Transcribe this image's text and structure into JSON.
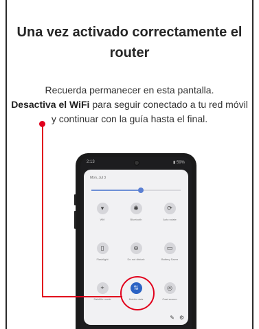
{
  "header": {
    "title": "Una vez activado correctamente el router"
  },
  "description": {
    "line1": "Recuerda permanecer en esta pantalla.",
    "bold": "Desactiva el WiFi",
    "rest": " para seguir conectado a tu red móvil y continuar con la guía hasta el final."
  },
  "phone": {
    "status": {
      "time": "2:13",
      "battery": "▮ 59%"
    },
    "panel": {
      "date": "Mon, Jul 3",
      "brightness_level": 0.55,
      "tiles": [
        {
          "label": "Wifi",
          "icon": "wifi-icon",
          "glyph": "▾"
        },
        {
          "label": "Bluetooth",
          "icon": "bluetooth-icon",
          "glyph": "✱"
        },
        {
          "label": "Auto rotate",
          "icon": "auto-rotate-icon",
          "glyph": "⟳"
        },
        {
          "label": "Flashlight",
          "icon": "flashlight-icon",
          "glyph": "▯"
        },
        {
          "label": "Do not disturb",
          "icon": "do-not-disturb-icon",
          "glyph": "⊖"
        },
        {
          "label": "Battery Saver",
          "icon": "battery-saver-icon",
          "glyph": "▭"
        },
        {
          "label": "Satellite mode",
          "icon": "add-icon",
          "glyph": "+"
        },
        {
          "label": "Mobile data",
          "icon": "mobile-data-icon",
          "glyph": "⇅",
          "active": true
        },
        {
          "label": "Cast screen",
          "icon": "cast-icon",
          "glyph": "◎"
        }
      ],
      "edit_icon": "pencil-icon",
      "edit_glyph": "✎",
      "settings_icon": "gear-icon",
      "settings_glyph": "⚙"
    }
  },
  "colors": {
    "accent_red": "#e1001c",
    "toggle_blue": "#2b63c4"
  }
}
